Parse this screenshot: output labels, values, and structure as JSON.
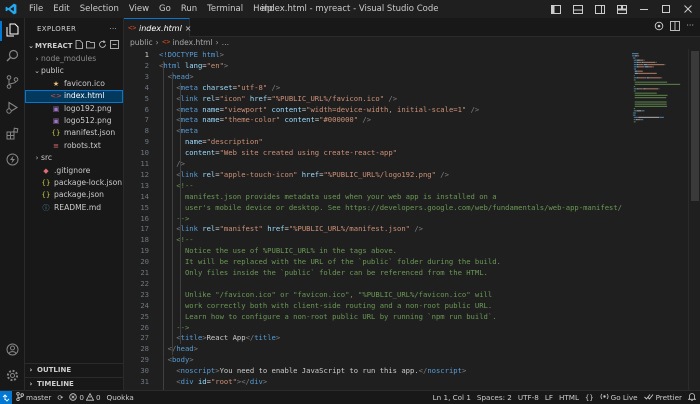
{
  "window": {
    "title": "index.html - myreact - Visual Studio Code",
    "menu": [
      "File",
      "Edit",
      "Selection",
      "View",
      "Go",
      "Run",
      "Terminal",
      "Help"
    ]
  },
  "sidebar": {
    "header": "EXPLORER",
    "more": "···",
    "project": "MYREACT",
    "tree": [
      {
        "label": "node_modules",
        "depth": 1,
        "type": "folder",
        "open": false,
        "color": "#8c8c8c",
        "icon": "chevron-right-icon"
      },
      {
        "label": "public",
        "depth": 1,
        "type": "folder",
        "open": true,
        "color": "#cccccc",
        "icon": "chevron-down-icon"
      },
      {
        "label": "favicon.ico",
        "depth": 2,
        "type": "file",
        "color": "#cccccc",
        "icon": "star-icon",
        "iconColor": "#e5c07b"
      },
      {
        "label": "index.html",
        "depth": 2,
        "type": "file",
        "color": "#ffffff",
        "icon": "html-icon",
        "iconColor": "#e44d26",
        "selected": true
      },
      {
        "label": "logo192.png",
        "depth": 2,
        "type": "file",
        "color": "#cccccc",
        "icon": "image-icon",
        "iconColor": "#a074c4"
      },
      {
        "label": "logo512.png",
        "depth": 2,
        "type": "file",
        "color": "#cccccc",
        "icon": "image-icon",
        "iconColor": "#a074c4"
      },
      {
        "label": "manifest.json",
        "depth": 2,
        "type": "file",
        "color": "#cccccc",
        "icon": "json-icon",
        "iconColor": "#cbcb41"
      },
      {
        "label": "robots.txt",
        "depth": 2,
        "type": "file",
        "color": "#cccccc",
        "icon": "text-file-icon",
        "iconColor": "#e06c75"
      },
      {
        "label": "src",
        "depth": 1,
        "type": "folder",
        "open": false,
        "color": "#cccccc",
        "icon": "chevron-right-icon"
      },
      {
        "label": ".gitignore",
        "depth": 1,
        "type": "file",
        "color": "#cccccc",
        "icon": "git-icon",
        "iconColor": "#e06c75"
      },
      {
        "label": "package-lock.json",
        "depth": 1,
        "type": "file",
        "color": "#cccccc",
        "icon": "json-icon",
        "iconColor": "#cbcb41"
      },
      {
        "label": "package.json",
        "depth": 1,
        "type": "file",
        "color": "#cccccc",
        "icon": "json-icon",
        "iconColor": "#cbcb41"
      },
      {
        "label": "README.md",
        "depth": 1,
        "type": "file",
        "color": "#cccccc",
        "icon": "info-icon",
        "iconColor": "#519aba"
      }
    ],
    "outline": "OUTLINE",
    "timeline": "TIMELINE"
  },
  "tab": {
    "label": "index.html",
    "close": "×"
  },
  "breadcrumb": {
    "folder": "public",
    "sep": "›",
    "file": "index.html",
    "tail": "…"
  },
  "editor": {
    "current_line": 1,
    "first_line_number": 1,
    "lines": [
      [
        [
          "<!DOCTYPE ",
          "#569cd6"
        ],
        [
          "html",
          "#569cd6"
        ],
        [
          ">",
          "#808080"
        ]
      ],
      [
        [
          "<",
          "#808080"
        ],
        [
          "html",
          "#569cd6"
        ],
        [
          " lang",
          "#9cdcfe"
        ],
        [
          "=",
          "#cccccc"
        ],
        [
          "\"en\"",
          "#ce9178"
        ],
        [
          ">",
          "#808080"
        ]
      ],
      [
        [
          "  <",
          "#808080"
        ],
        [
          "head",
          "#569cd6"
        ],
        [
          ">",
          "#808080"
        ]
      ],
      [
        [
          "    <",
          "#808080"
        ],
        [
          "meta",
          "#569cd6"
        ],
        [
          " charset",
          "#9cdcfe"
        ],
        [
          "=",
          "#cccccc"
        ],
        [
          "\"utf-8\"",
          "#ce9178"
        ],
        [
          " />",
          "#808080"
        ]
      ],
      [
        [
          "    <",
          "#808080"
        ],
        [
          "link",
          "#569cd6"
        ],
        [
          " rel",
          "#9cdcfe"
        ],
        [
          "=",
          "#cccccc"
        ],
        [
          "\"icon\"",
          "#ce9178"
        ],
        [
          " href",
          "#9cdcfe"
        ],
        [
          "=",
          "#cccccc"
        ],
        [
          "\"%PUBLIC_URL%/favicon.ico\"",
          "#ce9178"
        ],
        [
          " />",
          "#808080"
        ]
      ],
      [
        [
          "    <",
          "#808080"
        ],
        [
          "meta",
          "#569cd6"
        ],
        [
          " name",
          "#9cdcfe"
        ],
        [
          "=",
          "#cccccc"
        ],
        [
          "\"viewport\"",
          "#ce9178"
        ],
        [
          " content",
          "#9cdcfe"
        ],
        [
          "=",
          "#cccccc"
        ],
        [
          "\"width=device-width, initial-scale=1\"",
          "#ce9178"
        ],
        [
          " />",
          "#808080"
        ]
      ],
      [
        [
          "    <",
          "#808080"
        ],
        [
          "meta",
          "#569cd6"
        ],
        [
          " name",
          "#9cdcfe"
        ],
        [
          "=",
          "#cccccc"
        ],
        [
          "\"theme-color\"",
          "#ce9178"
        ],
        [
          " content",
          "#9cdcfe"
        ],
        [
          "=",
          "#cccccc"
        ],
        [
          "\"#000000\"",
          "#ce9178"
        ],
        [
          " />",
          "#808080"
        ]
      ],
      [
        [
          "    <",
          "#808080"
        ],
        [
          "meta",
          "#569cd6"
        ]
      ],
      [
        [
          "      name",
          "#9cdcfe"
        ],
        [
          "=",
          "#cccccc"
        ],
        [
          "\"description\"",
          "#ce9178"
        ]
      ],
      [
        [
          "      content",
          "#9cdcfe"
        ],
        [
          "=",
          "#cccccc"
        ],
        [
          "\"Web site created using create-react-app\"",
          "#ce9178"
        ]
      ],
      [
        [
          "    />",
          "#808080"
        ]
      ],
      [
        [
          "    <",
          "#808080"
        ],
        [
          "link",
          "#569cd6"
        ],
        [
          " rel",
          "#9cdcfe"
        ],
        [
          "=",
          "#cccccc"
        ],
        [
          "\"apple-touch-icon\"",
          "#ce9178"
        ],
        [
          " href",
          "#9cdcfe"
        ],
        [
          "=",
          "#cccccc"
        ],
        [
          "\"%PUBLIC_URL%/logo192.png\"",
          "#ce9178"
        ],
        [
          " />",
          "#808080"
        ]
      ],
      [
        [
          "    <!--",
          "#6a9955"
        ]
      ],
      [
        [
          "      manifest.json provides metadata used when your web app is installed on a",
          "#6a9955"
        ]
      ],
      [
        [
          "      user's mobile device or desktop. See https://developers.google.com/web/fundamentals/web-app-manifest/",
          "#6a9955"
        ]
      ],
      [
        [
          "    -->",
          "#6a9955"
        ]
      ],
      [
        [
          "    <",
          "#808080"
        ],
        [
          "link",
          "#569cd6"
        ],
        [
          " rel",
          "#9cdcfe"
        ],
        [
          "=",
          "#cccccc"
        ],
        [
          "\"manifest\"",
          "#ce9178"
        ],
        [
          " href",
          "#9cdcfe"
        ],
        [
          "=",
          "#cccccc"
        ],
        [
          "\"%PUBLIC_URL%/manifest.json\"",
          "#ce9178"
        ],
        [
          " />",
          "#808080"
        ]
      ],
      [
        [
          "    <!--",
          "#6a9955"
        ]
      ],
      [
        [
          "      Notice the use of %PUBLIC_URL% in the tags above.",
          "#6a9955"
        ]
      ],
      [
        [
          "      It will be replaced with the URL of the `public` folder during the build.",
          "#6a9955"
        ]
      ],
      [
        [
          "      Only files inside the `public` folder can be referenced from the HTML.",
          "#6a9955"
        ]
      ],
      [
        [
          "",
          "#6a9955"
        ]
      ],
      [
        [
          "      Unlike \"/favicon.ico\" or \"favicon.ico\", \"%PUBLIC_URL%/favicon.ico\" will",
          "#6a9955"
        ]
      ],
      [
        [
          "      work correctly both with client-side routing and a non-root public URL.",
          "#6a9955"
        ]
      ],
      [
        [
          "      Learn how to configure a non-root public URL by running `npm run build`.",
          "#6a9955"
        ]
      ],
      [
        [
          "    -->",
          "#6a9955"
        ]
      ],
      [
        [
          "    <",
          "#808080"
        ],
        [
          "title",
          "#569cd6"
        ],
        [
          ">",
          "#808080"
        ],
        [
          "React App",
          "#cccccc"
        ],
        [
          "</",
          "#808080"
        ],
        [
          "title",
          "#569cd6"
        ],
        [
          ">",
          "#808080"
        ]
      ],
      [
        [
          "  </",
          "#808080"
        ],
        [
          "head",
          "#569cd6"
        ],
        [
          ">",
          "#808080"
        ]
      ],
      [
        [
          "  <",
          "#808080"
        ],
        [
          "body",
          "#569cd6"
        ],
        [
          ">",
          "#808080"
        ]
      ],
      [
        [
          "    <",
          "#808080"
        ],
        [
          "noscript",
          "#569cd6"
        ],
        [
          ">",
          "#808080"
        ],
        [
          "You need to enable JavaScript to run this app.",
          "#cccccc"
        ],
        [
          "</",
          "#808080"
        ],
        [
          "noscript",
          "#569cd6"
        ],
        [
          ">",
          "#808080"
        ]
      ],
      [
        [
          "    <",
          "#808080"
        ],
        [
          "div",
          "#569cd6"
        ],
        [
          " id",
          "#9cdcfe"
        ],
        [
          "=",
          "#cccccc"
        ],
        [
          "\"root\"",
          "#ce9178"
        ],
        [
          "></",
          "#808080"
        ],
        [
          "div",
          "#569cd6"
        ],
        [
          ">",
          "#808080"
        ]
      ],
      [
        [
          "    <!--",
          "#6a9955"
        ]
      ]
    ]
  },
  "status": {
    "branch": "master",
    "sync": "⟳",
    "errors": "0",
    "warnings": "0",
    "extension": "Quokka",
    "position": "Ln 1, Col 1",
    "spaces": "Spaces: 2",
    "encoding": "UTF-8",
    "eol": "LF",
    "language": "HTML",
    "golive": "Go Live",
    "prettier": "Prettier"
  },
  "colors": {
    "accent": "#0078d4",
    "selection": "#04395e"
  }
}
